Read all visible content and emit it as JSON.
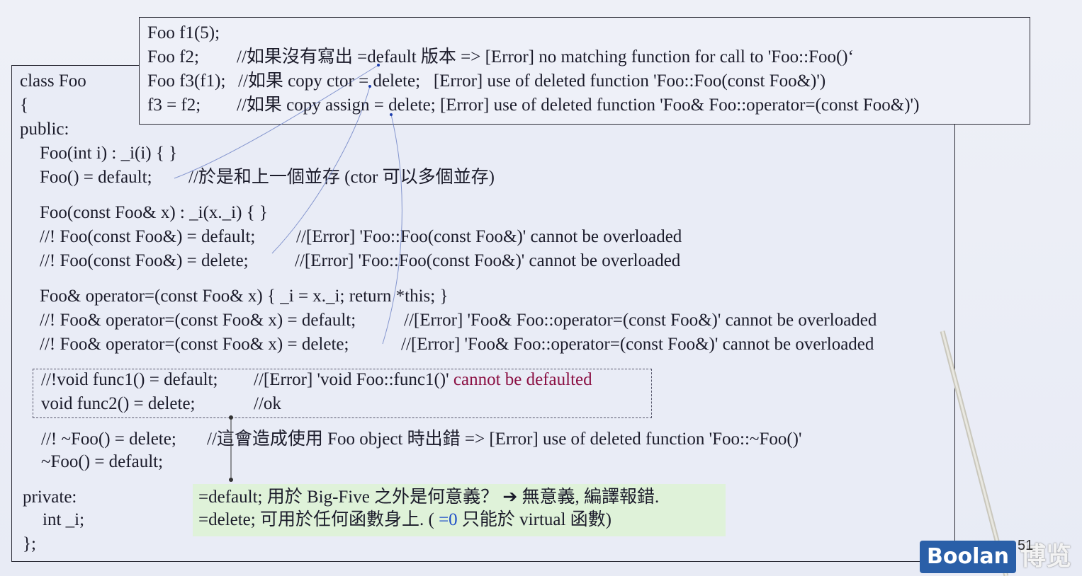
{
  "call_box": {
    "lines": [
      {
        "code": "Foo f1(5);",
        "comment": ""
      },
      {
        "code": "Foo f2;",
        "comment": "//如果沒有寫出 =default 版本 => [Error] no matching function for call to 'Foo::Foo()‘"
      },
      {
        "code": "Foo f3(f1);",
        "comment": "//如果 copy ctor = delete;   [Error] use of deleted function 'Foo::Foo(const Foo&)')"
      },
      {
        "code": "f3 = f2;",
        "comment": "//如果 copy assign = delete; [Error] use of deleted function 'Foo& Foo::operator=(const Foo&)')"
      }
    ]
  },
  "class_box": {
    "class_head": "class Foo",
    "open_brace": "{",
    "public_label": "public:",
    "ctor_int": "Foo(int i) : _i(i) { }",
    "ctor_default_code": "Foo() = default;",
    "ctor_default_comment": "//於是和上一個並存 (ctor 可以多個並存)",
    "copy_ctor": "Foo(const Foo& x) : _i(x._i) { }",
    "copy_ctor_default_code": "//! Foo(const Foo&) = default;",
    "copy_ctor_default_comment": "//[Error] 'Foo::Foo(const Foo&)' cannot be overloaded",
    "copy_ctor_delete_code": "//! Foo(const Foo&) = delete;",
    "copy_ctor_delete_comment": "//[Error] 'Foo::Foo(const Foo&)' cannot be overloaded",
    "assign_op": "Foo& operator=(const Foo& x) { _i = x._i; return *this; }",
    "assign_default_code": "//! Foo& operator=(const Foo& x) = default;",
    "assign_default_comment": "//[Error] 'Foo& Foo::operator=(const Foo&)' cannot be overloaded",
    "assign_delete_code": "//! Foo& operator=(const Foo& x) = delete;",
    "assign_delete_comment": "//[Error] 'Foo& Foo::operator=(const Foo&)' cannot be overloaded",
    "func1_code": "//!void func1() = default;",
    "func1_comment_a": "//[Error] 'void Foo::func1()'",
    "func1_comment_b": "cannot be defaulted",
    "func2_code": "void func2() = delete;",
    "func2_comment": "//ok",
    "dtor_delete_code": "//! ~Foo() = delete;",
    "dtor_delete_comment": "//這會造成使用 Foo object 時出錯 => [Error] use of deleted function 'Foo::~Foo()'",
    "dtor_default": "~Foo() = default;",
    "private_label": "private:",
    "member": "int _i;",
    "close": "};"
  },
  "note": {
    "line1": "=default; 用於 Big-Five 之外是何意義？ ➔ 無意義, 編譯報錯.",
    "line2_a": "=delete; 可用於任何函數身上. ( ",
    "line2_b": "=0",
    "line2_c": " 只能於 virtual 函數)"
  },
  "footer": {
    "logo_text": "Boolan",
    "logo_cn": "博览",
    "page_number": "51"
  },
  "colors": {
    "error_red": "#8b1144",
    "zero_blue": "#1e4fc8",
    "note_bg": "#dff2d9",
    "logo_bg": "#2a5fa8"
  }
}
